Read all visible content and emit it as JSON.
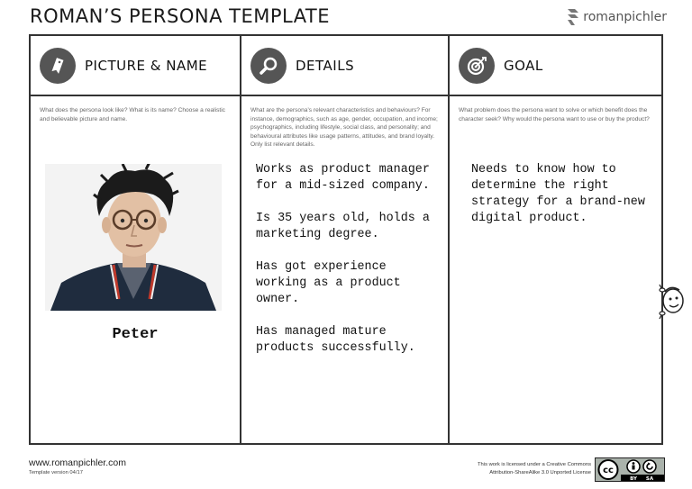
{
  "header": {
    "title": "ROMAN’S PERSONA TEMPLATE",
    "brand": "romanpichler",
    "brand_icon": "romanpichler-logo-icon"
  },
  "columns": {
    "picture": {
      "icon": "tag-icon",
      "label": "PICTURE & NAME",
      "hint": "What does the persona look like? What is its name? Choose a realistic and believable picture and name.",
      "person_name": "Peter"
    },
    "details": {
      "icon": "magnifier-icon",
      "label": "DETAILS",
      "hint": "What are the persona’s relevant characteristics and behaviours? For instance, demographics, such as age, gender, occupation, and income; psychographics, including lifestyle, social class, and personality; and behavioural attributes like usage patterns, attitudes, and brand loyalty. Only list relevant details.",
      "notes": [
        "Works as product manager for a mid-sized company.",
        "Is 35 years old, holds a marketing degree.",
        "Has got experience working as a product owner.",
        "Has managed mature products successfully."
      ]
    },
    "goal": {
      "icon": "target-icon",
      "label": "GOAL",
      "hint": "What problem does the persona want to solve or which benefit does the character seek? Why would the persona want to use or buy the product?",
      "notes": [
        "Needs to know how to determine the right strategy for a brand-new digital product."
      ]
    }
  },
  "footer": {
    "url": "www.romanpichler.com",
    "version": "Template version 04/17",
    "license_line1": "This work is licensed under a Creative Commons",
    "license_line2": "Attribution-ShareAlike 3.0 Unported License",
    "badge": {
      "cc": "cc",
      "by": "BY",
      "sa": "SA"
    }
  }
}
